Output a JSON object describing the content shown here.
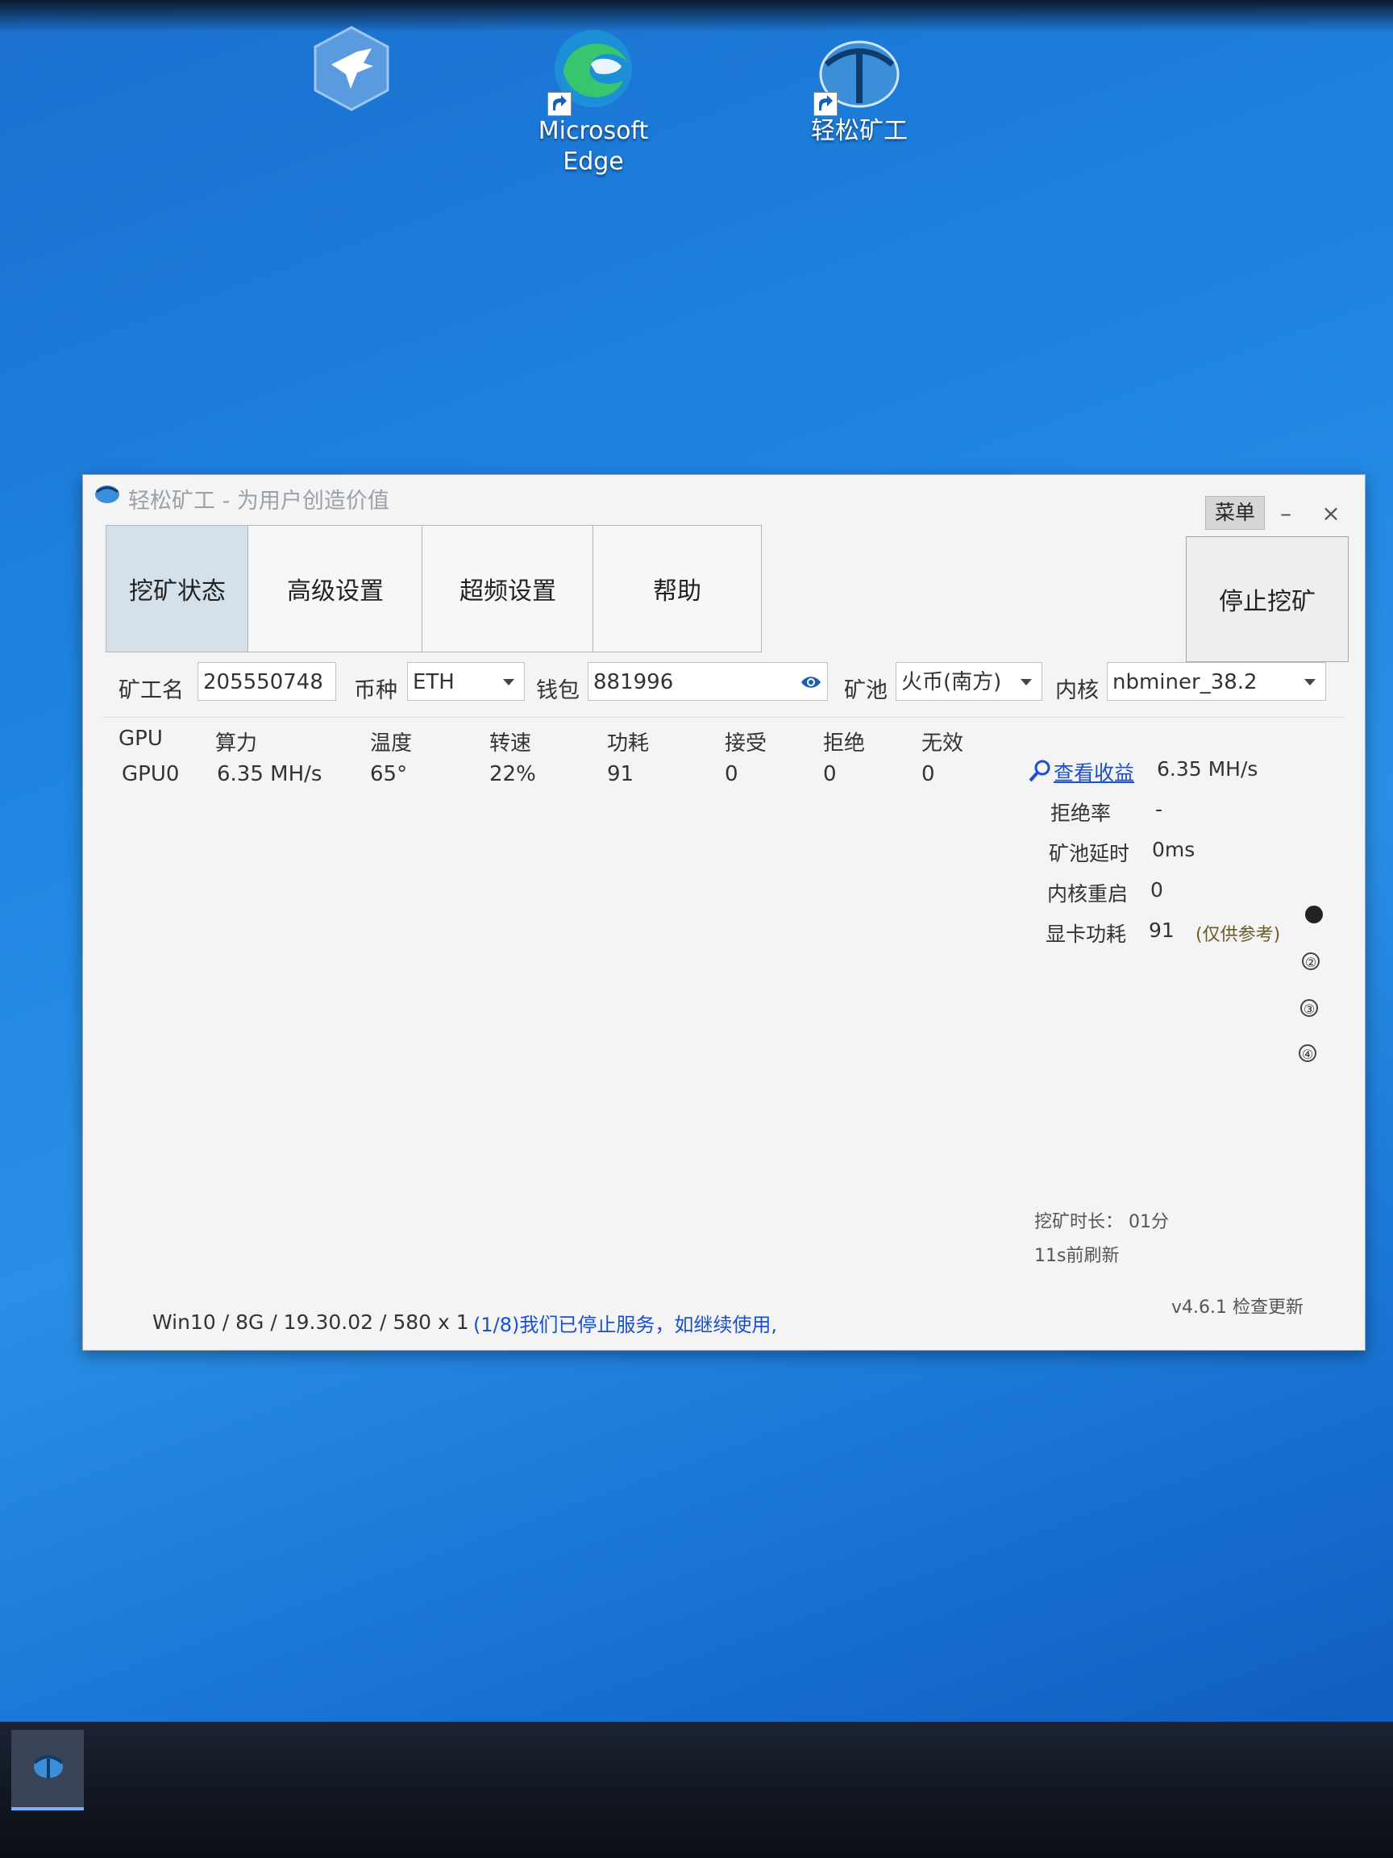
{
  "desktop": {
    "icons": [
      {
        "label": ""
      },
      {
        "label": "Microsoft\nEdge"
      },
      {
        "label": "轻松矿工"
      }
    ]
  },
  "window": {
    "title": "轻松矿工 - 为用户创造价值",
    "menu_label": "菜单",
    "minimize": "–",
    "close": "×"
  },
  "tabs": [
    {
      "label": "挖矿状态",
      "active": true
    },
    {
      "label": "高级设置",
      "active": false
    },
    {
      "label": "超频设置",
      "active": false
    },
    {
      "label": "帮助",
      "active": false
    }
  ],
  "stop_button": "停止挖矿",
  "form": {
    "miner_label": "矿工名",
    "miner_value": "205550748",
    "coin_label": "币种",
    "coin_value": "ETH",
    "wallet_label": "钱包",
    "wallet_value": "881996",
    "pool_label": "矿池",
    "pool_value": "火币(南方)",
    "kernel_label": "内核",
    "kernel_value": "nbminer_38.2"
  },
  "gpu_table": {
    "headers": [
      "GPU",
      "算力",
      "温度",
      "转速",
      "功耗",
      "接受",
      "拒绝",
      "无效"
    ],
    "rows": [
      [
        "GPU0",
        "6.35 MH/s",
        "65°",
        "22%",
        "91",
        "0",
        "0",
        "0"
      ]
    ]
  },
  "stats": {
    "earnings_link": "查看收益",
    "hashrate": "6.35 MH/s",
    "reject_rate_label": "拒绝率",
    "reject_rate": "-",
    "pool_latency_label": "矿池延时",
    "pool_latency": "0ms",
    "kernel_restart_label": "内核重启",
    "kernel_restart": "0",
    "gpu_power_label": "显卡功耗",
    "gpu_power": "91",
    "gpu_power_note": "(仅供参考)"
  },
  "pager": [
    "",
    "②",
    "③",
    "④"
  ],
  "mining_time": "挖矿时长：  01分",
  "refresh": "11s前刷新",
  "status": {
    "sys_info": "Win10  / 8G / 19.30.02 / 580 x 1",
    "notice": "(1/8)我们已停止服务，如继续使用,",
    "version": "v4.6.1 检查更新"
  },
  "colors": {
    "accent": "#1a4fd0",
    "active_tab": "#d4e1eb",
    "desktop": "#1f86e2"
  }
}
